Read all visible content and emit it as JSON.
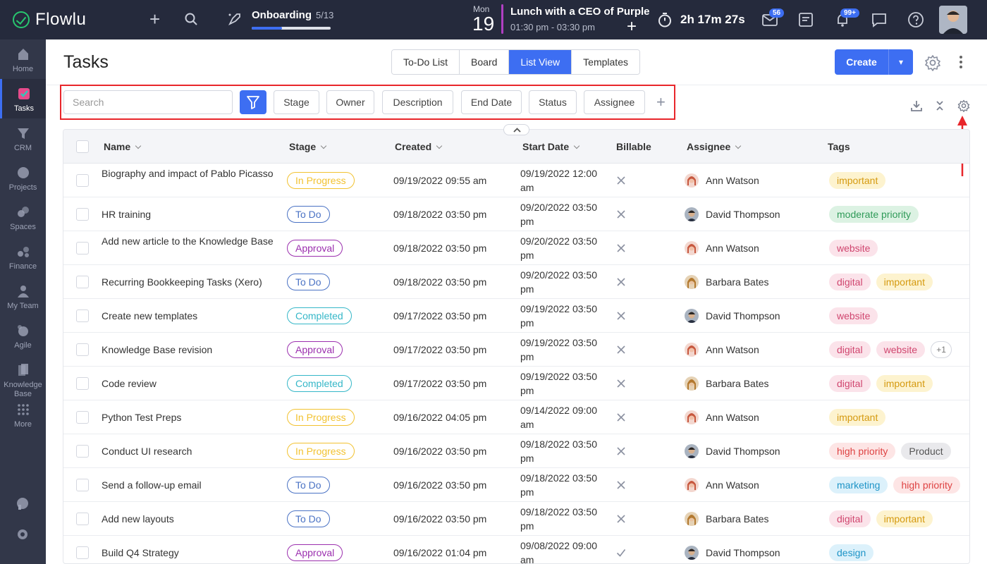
{
  "app": {
    "name": "Flowlu"
  },
  "topbar": {
    "onboarding": {
      "title": "Onboarding",
      "count": "5/13",
      "progress": 0.385
    },
    "calendar": {
      "weekday": "Mon",
      "day": "19"
    },
    "event": {
      "title": "Lunch with a CEO of Purple",
      "time": "01:30 pm - 03:30 pm"
    },
    "timer": "2h 17m 27s",
    "mail_badge": "56",
    "notifications_badge": "99+"
  },
  "sidebar": {
    "items": [
      {
        "label": "Home",
        "icon": "home-icon"
      },
      {
        "label": "Tasks",
        "icon": "tasks-icon",
        "active": true
      },
      {
        "label": "CRM",
        "icon": "crm-icon"
      },
      {
        "label": "Projects",
        "icon": "projects-icon"
      },
      {
        "label": "Spaces",
        "icon": "spaces-icon"
      },
      {
        "label": "Finance",
        "icon": "finance-icon"
      },
      {
        "label": "My Team",
        "icon": "team-icon"
      },
      {
        "label": "Agile",
        "icon": "agile-icon"
      },
      {
        "label": "Knowledge Base",
        "icon": "knowledge-base-icon"
      },
      {
        "label": "More",
        "icon": "grid-icon"
      }
    ]
  },
  "header": {
    "title": "Tasks",
    "tabs": [
      {
        "label": "To-Do List"
      },
      {
        "label": "Board"
      },
      {
        "label": "List View",
        "active": true
      },
      {
        "label": "Templates"
      }
    ],
    "create_label": "Create"
  },
  "filters": {
    "search_placeholder": "Search",
    "chips": [
      "Stage",
      "Owner",
      "Description",
      "End Date",
      "Status",
      "Assignee"
    ]
  },
  "table": {
    "columns": {
      "name": "Name",
      "stage": "Stage",
      "created": "Created",
      "start_date": "Start Date",
      "billable": "Billable",
      "assignee": "Assignee",
      "tags": "Tags"
    },
    "rows": [
      {
        "name": "Biography and impact of Pablo Picasso",
        "stage": "In Progress",
        "created": "09/19/2022 09:55 am",
        "start": "09/19/2022 12:00 am",
        "billable": false,
        "assignee": "Ann Watson",
        "tags": [
          "important"
        ]
      },
      {
        "name": "HR training",
        "stage": "To Do",
        "created": "09/18/2022 03:50 pm",
        "start": "09/20/2022 03:50 pm",
        "billable": false,
        "assignee": "David Thompson",
        "tags": [
          "moderate priority"
        ]
      },
      {
        "name": "Add new article to the Knowledge Base",
        "stage": "Approval",
        "created": "09/18/2022 03:50 pm",
        "start": "09/20/2022 03:50 pm",
        "billable": false,
        "assignee": "Ann Watson",
        "tags": [
          "website"
        ]
      },
      {
        "name": "Recurring Bookkeeping Tasks (Xero)",
        "stage": "To Do",
        "created": "09/18/2022 03:50 pm",
        "start": "09/20/2022 03:50 pm",
        "billable": false,
        "assignee": "Barbara Bates",
        "tags": [
          "digital",
          "important"
        ]
      },
      {
        "name": "Create new templates",
        "stage": "Completed",
        "created": "09/17/2022 03:50 pm",
        "start": "09/19/2022 03:50 pm",
        "billable": false,
        "assignee": "David Thompson",
        "tags": [
          "website"
        ]
      },
      {
        "name": "Knowledge Base revision",
        "stage": "Approval",
        "created": "09/17/2022 03:50 pm",
        "start": "09/19/2022 03:50 pm",
        "billable": false,
        "assignee": "Ann Watson",
        "tags": [
          "digital",
          "website"
        ],
        "more": "+1"
      },
      {
        "name": "Code review",
        "stage": "Completed",
        "created": "09/17/2022 03:50 pm",
        "start": "09/19/2022 03:50 pm",
        "billable": false,
        "assignee": "Barbara Bates",
        "tags": [
          "digital",
          "important"
        ]
      },
      {
        "name": "Python Test Preps",
        "stage": "In Progress",
        "created": "09/16/2022 04:05 pm",
        "start": "09/14/2022 09:00 am",
        "billable": false,
        "assignee": "Ann Watson",
        "tags": [
          "important"
        ]
      },
      {
        "name": "Conduct UI research",
        "stage": "In Progress",
        "created": "09/16/2022 03:50 pm",
        "start": "09/18/2022 03:50 pm",
        "billable": false,
        "assignee": "David Thompson",
        "tags": [
          "high priority",
          "Product"
        ]
      },
      {
        "name": "Send a follow-up email",
        "stage": "To Do",
        "created": "09/16/2022 03:50 pm",
        "start": "09/18/2022 03:50 pm",
        "billable": false,
        "assignee": "Ann Watson",
        "tags": [
          "marketing",
          "high priority"
        ]
      },
      {
        "name": "Add new layouts",
        "stage": "To Do",
        "created": "09/16/2022 03:50 pm",
        "start": "09/18/2022 03:50 pm",
        "billable": false,
        "assignee": "Barbara Bates",
        "tags": [
          "digital",
          "important"
        ]
      },
      {
        "name": "Build Q4 Strategy",
        "stage": "Approval",
        "created": "09/16/2022 01:04 pm",
        "start": "09/08/2022 09:00 am",
        "billable": true,
        "assignee": "David Thompson",
        "tags": [
          "design"
        ]
      }
    ]
  },
  "colors": {
    "accent": "#3d6ef2",
    "topbar": "#252a3c",
    "sidebar": "#323749",
    "highlight": "#e8262b",
    "stages": {
      "In Progress": "#f2c230",
      "To Do": "#4a72c4",
      "Approval": "#9b2fae",
      "Completed": "#35b7c8"
    },
    "tags": {
      "important": {
        "bg": "#fdf3cf",
        "fg": "#d59a10"
      },
      "moderate priority": {
        "bg": "#dcf2e3",
        "fg": "#2f9a58"
      },
      "website": {
        "bg": "#fbe3ea",
        "fg": "#d0466f"
      },
      "digital": {
        "bg": "#fbe3ea",
        "fg": "#d0466f"
      },
      "high priority": {
        "bg": "#fde5e5",
        "fg": "#de4343"
      },
      "Product": {
        "bg": "#e9e9ec",
        "fg": "#555555"
      },
      "marketing": {
        "bg": "#dcf1fb",
        "fg": "#1e94c7"
      },
      "design": {
        "bg": "#dcf1fb",
        "fg": "#1e94c7"
      }
    }
  }
}
